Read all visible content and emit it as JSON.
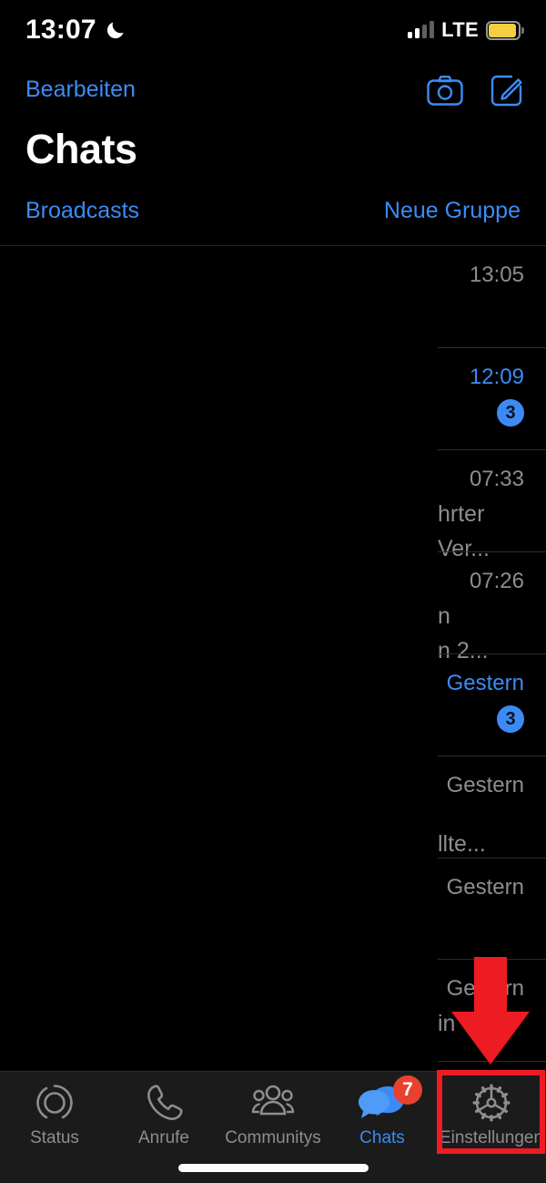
{
  "status_bar": {
    "time": "13:07",
    "dnd_icon": "crescent-moon-icon",
    "signal_icon": "cellular-signal-icon",
    "signal_bars_filled": 2,
    "signal_bars_total": 4,
    "network": "LTE",
    "battery_icon": "battery-low-power-icon",
    "battery_color": "#F5CE42"
  },
  "header": {
    "edit_label": "Bearbeiten",
    "camera_icon": "camera-icon",
    "compose_icon": "compose-icon",
    "title": "Chats",
    "broadcasts_label": "Broadcasts",
    "new_group_label": "Neue Gruppe",
    "accent_color": "#3C8BF5"
  },
  "chat_list": {
    "rows": [
      {
        "time": "13:05",
        "unread": false,
        "badge": "",
        "snippet1": "",
        "snippet2": ""
      },
      {
        "time": "12:09",
        "unread": true,
        "badge": "3",
        "snippet1": "",
        "snippet2": ""
      },
      {
        "time": "07:33",
        "unread": false,
        "badge": "",
        "snippet1": "hrter",
        "snippet2": "Ver..."
      },
      {
        "time": "07:26",
        "unread": false,
        "badge": "",
        "snippet1": "n",
        "snippet2": "n 2..."
      },
      {
        "time": "Gestern",
        "unread": true,
        "badge": "3",
        "snippet1": "",
        "snippet2": ""
      },
      {
        "time": "Gestern",
        "unread": false,
        "badge": "",
        "snippet1": "",
        "snippet2": "llte..."
      },
      {
        "time": "Gestern",
        "unread": false,
        "badge": "",
        "snippet1": "",
        "snippet2": ""
      },
      {
        "time": "Gestern",
        "unread": false,
        "badge": "",
        "snippet1": "",
        "snippet2": "in"
      }
    ]
  },
  "annotation": {
    "arrow_color": "#EE1B22",
    "arrow_icon": "down-arrow-icon",
    "highlight_color": "#EE1B22",
    "highlight_target": "Einstellungen"
  },
  "tab_bar": {
    "tabs": [
      {
        "label": "Status",
        "icon": "status-rings-icon",
        "active": false,
        "badge": ""
      },
      {
        "label": "Anrufe",
        "icon": "phone-icon",
        "active": false,
        "badge": ""
      },
      {
        "label": "Communitys",
        "icon": "community-group-icon",
        "active": false,
        "badge": ""
      },
      {
        "label": "Chats",
        "icon": "chat-bubbles-icon",
        "active": true,
        "badge": "7"
      },
      {
        "label": "Einstellungen",
        "icon": "gear-icon",
        "active": false,
        "badge": ""
      }
    ],
    "badge_color": "#E8422E",
    "active_color": "#3C8BF5",
    "inactive_color": "#8D8D92"
  },
  "home_indicator": "home-indicator"
}
